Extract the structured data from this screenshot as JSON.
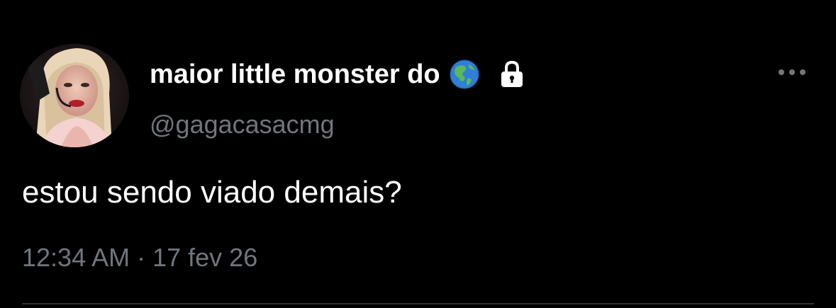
{
  "user": {
    "display_name": "maior little monster do",
    "handle": "@gagacasacmg",
    "badge_icons": [
      "globe-americas-icon",
      "lock-icon"
    ]
  },
  "tweet": {
    "text": "estou sendo viado demais?",
    "time": "12:34 AM",
    "separator": "·",
    "date": "17 fev 26"
  },
  "icons": {
    "more": "more-horizontal-icon"
  },
  "colors": {
    "background": "#000000",
    "primary_text": "#ffffff",
    "secondary_text": "#71767b",
    "divider": "#2f3336"
  }
}
